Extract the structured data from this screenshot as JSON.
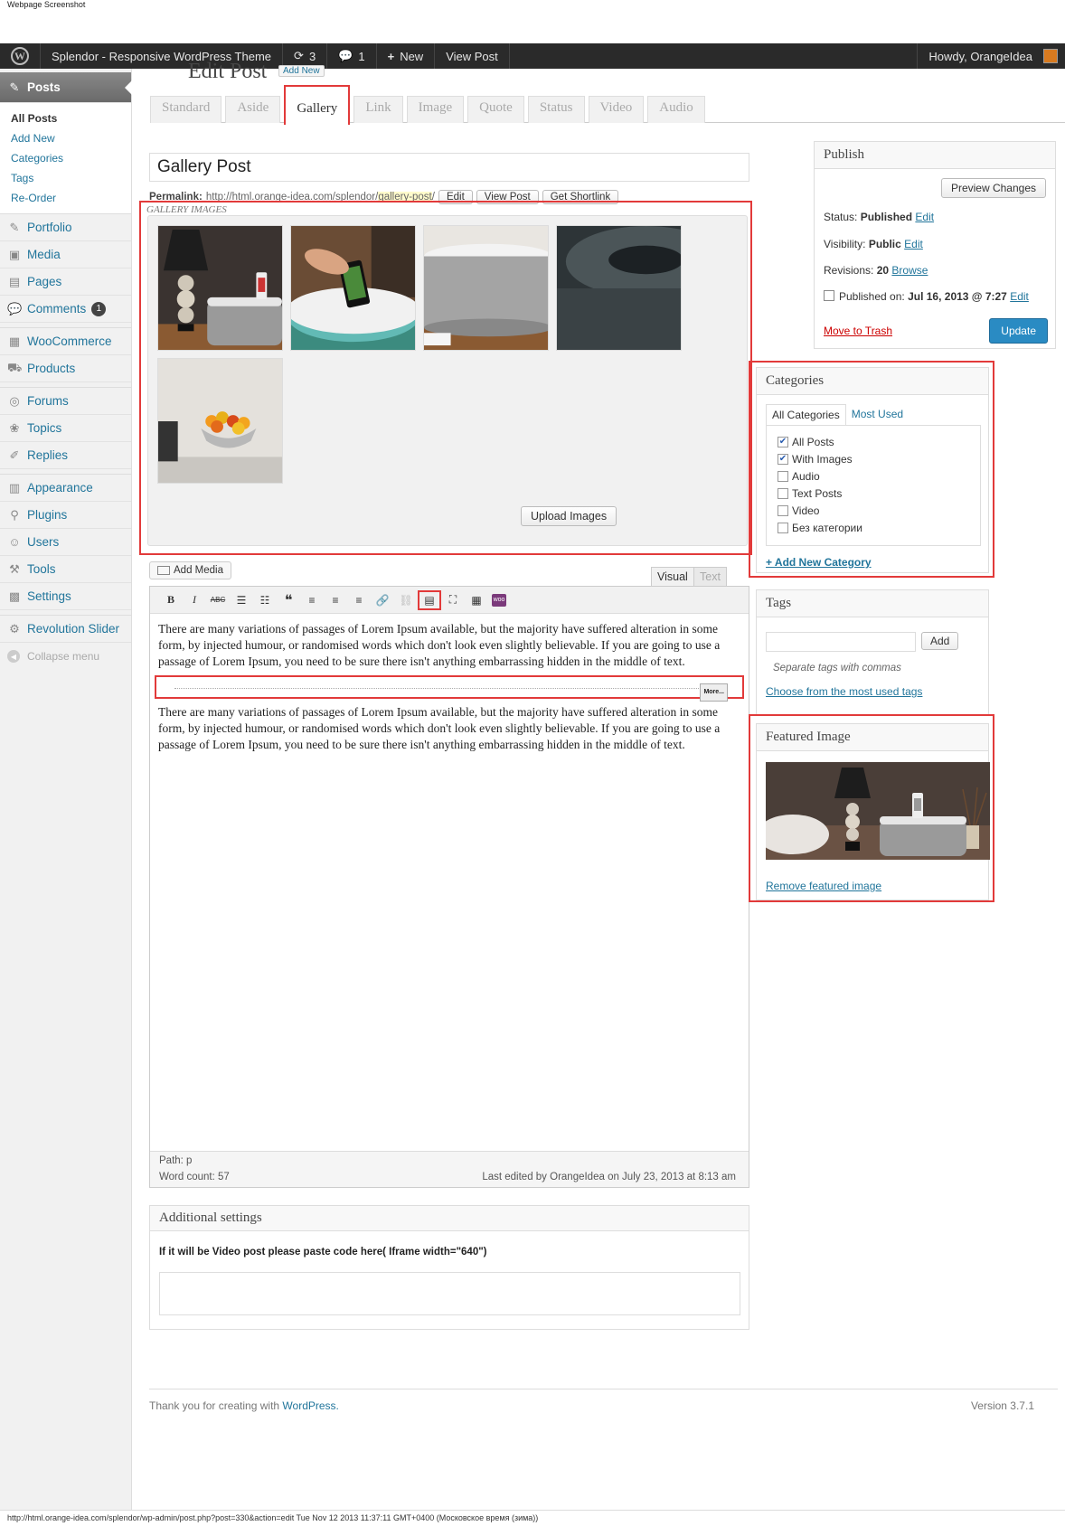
{
  "page_caption": "Webpage Screenshot",
  "adminbar": {
    "site_name": "Splendor - Responsive WordPress Theme",
    "updates_count": "3",
    "comments_count": "1",
    "new_label": "New",
    "view_post_label": "View Post",
    "howdy": "Howdy, OrangeIdea"
  },
  "sidebar": {
    "posts": "Posts",
    "submenu": [
      "All Posts",
      "Add New",
      "Categories",
      "Tags",
      "Re-Order"
    ],
    "portfolio": "Portfolio",
    "media": "Media",
    "pages": "Pages",
    "comments": "Comments",
    "comments_badge": "1",
    "woocommerce": "WooCommerce",
    "products": "Products",
    "forums": "Forums",
    "topics": "Topics",
    "replies": "Replies",
    "appearance": "Appearance",
    "plugins": "Plugins",
    "users": "Users",
    "tools": "Tools",
    "settings": "Settings",
    "revolution": "Revolution Slider",
    "collapse": "Collapse menu"
  },
  "main": {
    "heading": "Edit Post",
    "add_new": "Add New",
    "format_tabs": [
      "Standard",
      "Aside",
      "Gallery",
      "Link",
      "Image",
      "Quote",
      "Status",
      "Video",
      "Audio"
    ],
    "post_title": "Gallery Post",
    "permalink_label": "Permalink:",
    "permalink_base": "http://html.orange-idea.com/splendor/",
    "permalink_slug": "gallery-post",
    "permalink_end": "/",
    "permalink_buttons": [
      "Edit",
      "View Post",
      "Get Shortlink"
    ],
    "gallery_label": "GALLERY IMAGES",
    "upload_images": "Upload Images",
    "add_media": "Add Media",
    "visual_tab": "Visual",
    "text_tab": "Text",
    "paragraph1": "There are many variations of passages of Lorem Ipsum available, but the majority have suffered alteration in some form, by injected humour, or randomised words which don't look even slightly believable. If you are going to use a passage of Lorem Ipsum, you need to be sure there isn't anything embarrassing hidden in the middle of text.",
    "more_tag": "More...",
    "paragraph2": "There are many variations of passages of Lorem Ipsum available, but the majority have suffered alteration in some form, by injected humour, or randomised words which don't look even slightly believable. If you are going to use a passage of Lorem Ipsum, you need to be sure there isn't anything embarrassing hidden in the middle of text.",
    "path": "Path: p",
    "word_count": "Word count: 57",
    "last_edited": "Last edited by OrangeIdea on July 23, 2013 at 8:13 am",
    "additional_title": "Additional settings",
    "additional_label": "If it will be Video post please paste code here( Iframe width=\"640\")",
    "footer_thanks": "Thank you for creating with",
    "footer_wp": "WordPress.",
    "version": "Version 3.7.1"
  },
  "publish": {
    "title": "Publish",
    "preview": "Preview Changes",
    "status_label": "Status:",
    "status_value": "Published",
    "visibility_label": "Visibility:",
    "visibility_value": "Public",
    "revisions_label": "Revisions:",
    "revisions_value": "20",
    "browse": "Browse",
    "published_label": "Published on:",
    "published_value": "Jul 16, 2013 @ 7:27",
    "edit": "Edit",
    "trash": "Move to Trash",
    "update": "Update"
  },
  "categories": {
    "title": "Categories",
    "tab_all": "All Categories",
    "tab_most": "Most Used",
    "items": [
      {
        "label": "All Posts",
        "checked": true
      },
      {
        "label": "With Images",
        "checked": true
      },
      {
        "label": "Audio",
        "checked": false
      },
      {
        "label": "Text Posts",
        "checked": false
      },
      {
        "label": "Video",
        "checked": false
      },
      {
        "label": "Без категории",
        "checked": false
      }
    ],
    "add_new": "+ Add New Category"
  },
  "tags": {
    "title": "Tags",
    "add": "Add",
    "hint": "Separate tags with commas",
    "choose": "Choose from the most used tags"
  },
  "featured": {
    "title": "Featured Image",
    "remove": "Remove featured image"
  },
  "statusbar": "http://html.orange-idea.com/splendor/wp-admin/post.php?post=330&action=edit Tue Nov 12 2013 11:37:11 GMT+0400 (Московское время (зима))",
  "colors": {
    "highlight_frame": "#e23a3a",
    "link": "#21759b",
    "update_button": "#2a8bc3",
    "admin_bar": "#2a2a2a"
  }
}
